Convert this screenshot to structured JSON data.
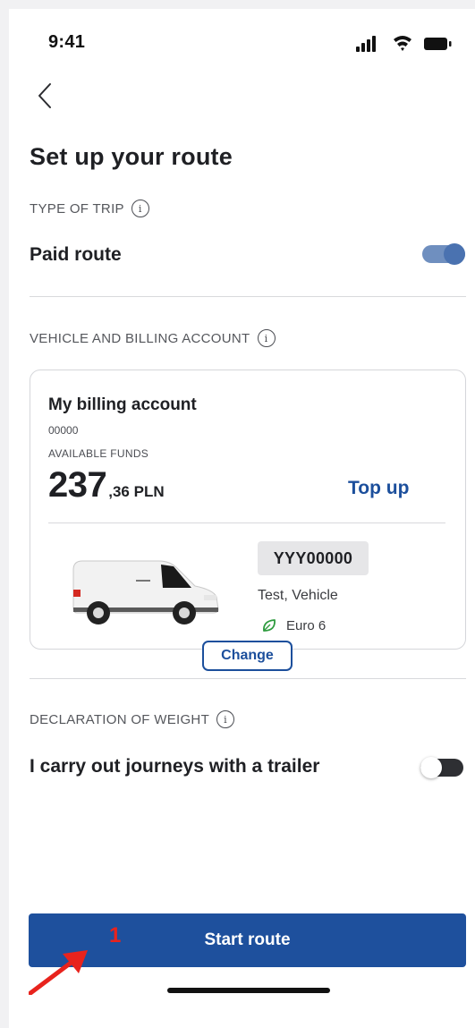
{
  "status_bar": {
    "time": "9:41",
    "icons": [
      "signal-icon",
      "wifi-icon",
      "battery-icon"
    ]
  },
  "header": {
    "back_icon": "chevron-left-icon",
    "title": "Set up your route"
  },
  "trip_type": {
    "label": "TYPE OF TRIP",
    "option_label": "Paid route",
    "toggle_on": true
  },
  "vehicle_billing": {
    "label": "VEHICLE AND BILLING ACCOUNT",
    "account_name": "My billing account",
    "account_number": "00000",
    "funds_label": "AVAILABLE FUNDS",
    "funds_integer": "237",
    "funds_fraction": ",36 PLN",
    "top_up_label": "Top up",
    "plate": "YYY00000",
    "vehicle_name": "Test, Vehicle",
    "emission_class": "Euro 6",
    "change_label": "Change"
  },
  "weight": {
    "label": "DECLARATION OF WEIGHT",
    "option_label": "I carry out journeys with a trailer",
    "toggle_on": false
  },
  "footer": {
    "start_label": "Start route"
  },
  "annotation": {
    "marker": "1"
  },
  "colors": {
    "primary": "#1e509d",
    "toggle_on": "#4a72b0",
    "marker": "#e8231d",
    "leaf": "#2e9b3e"
  }
}
